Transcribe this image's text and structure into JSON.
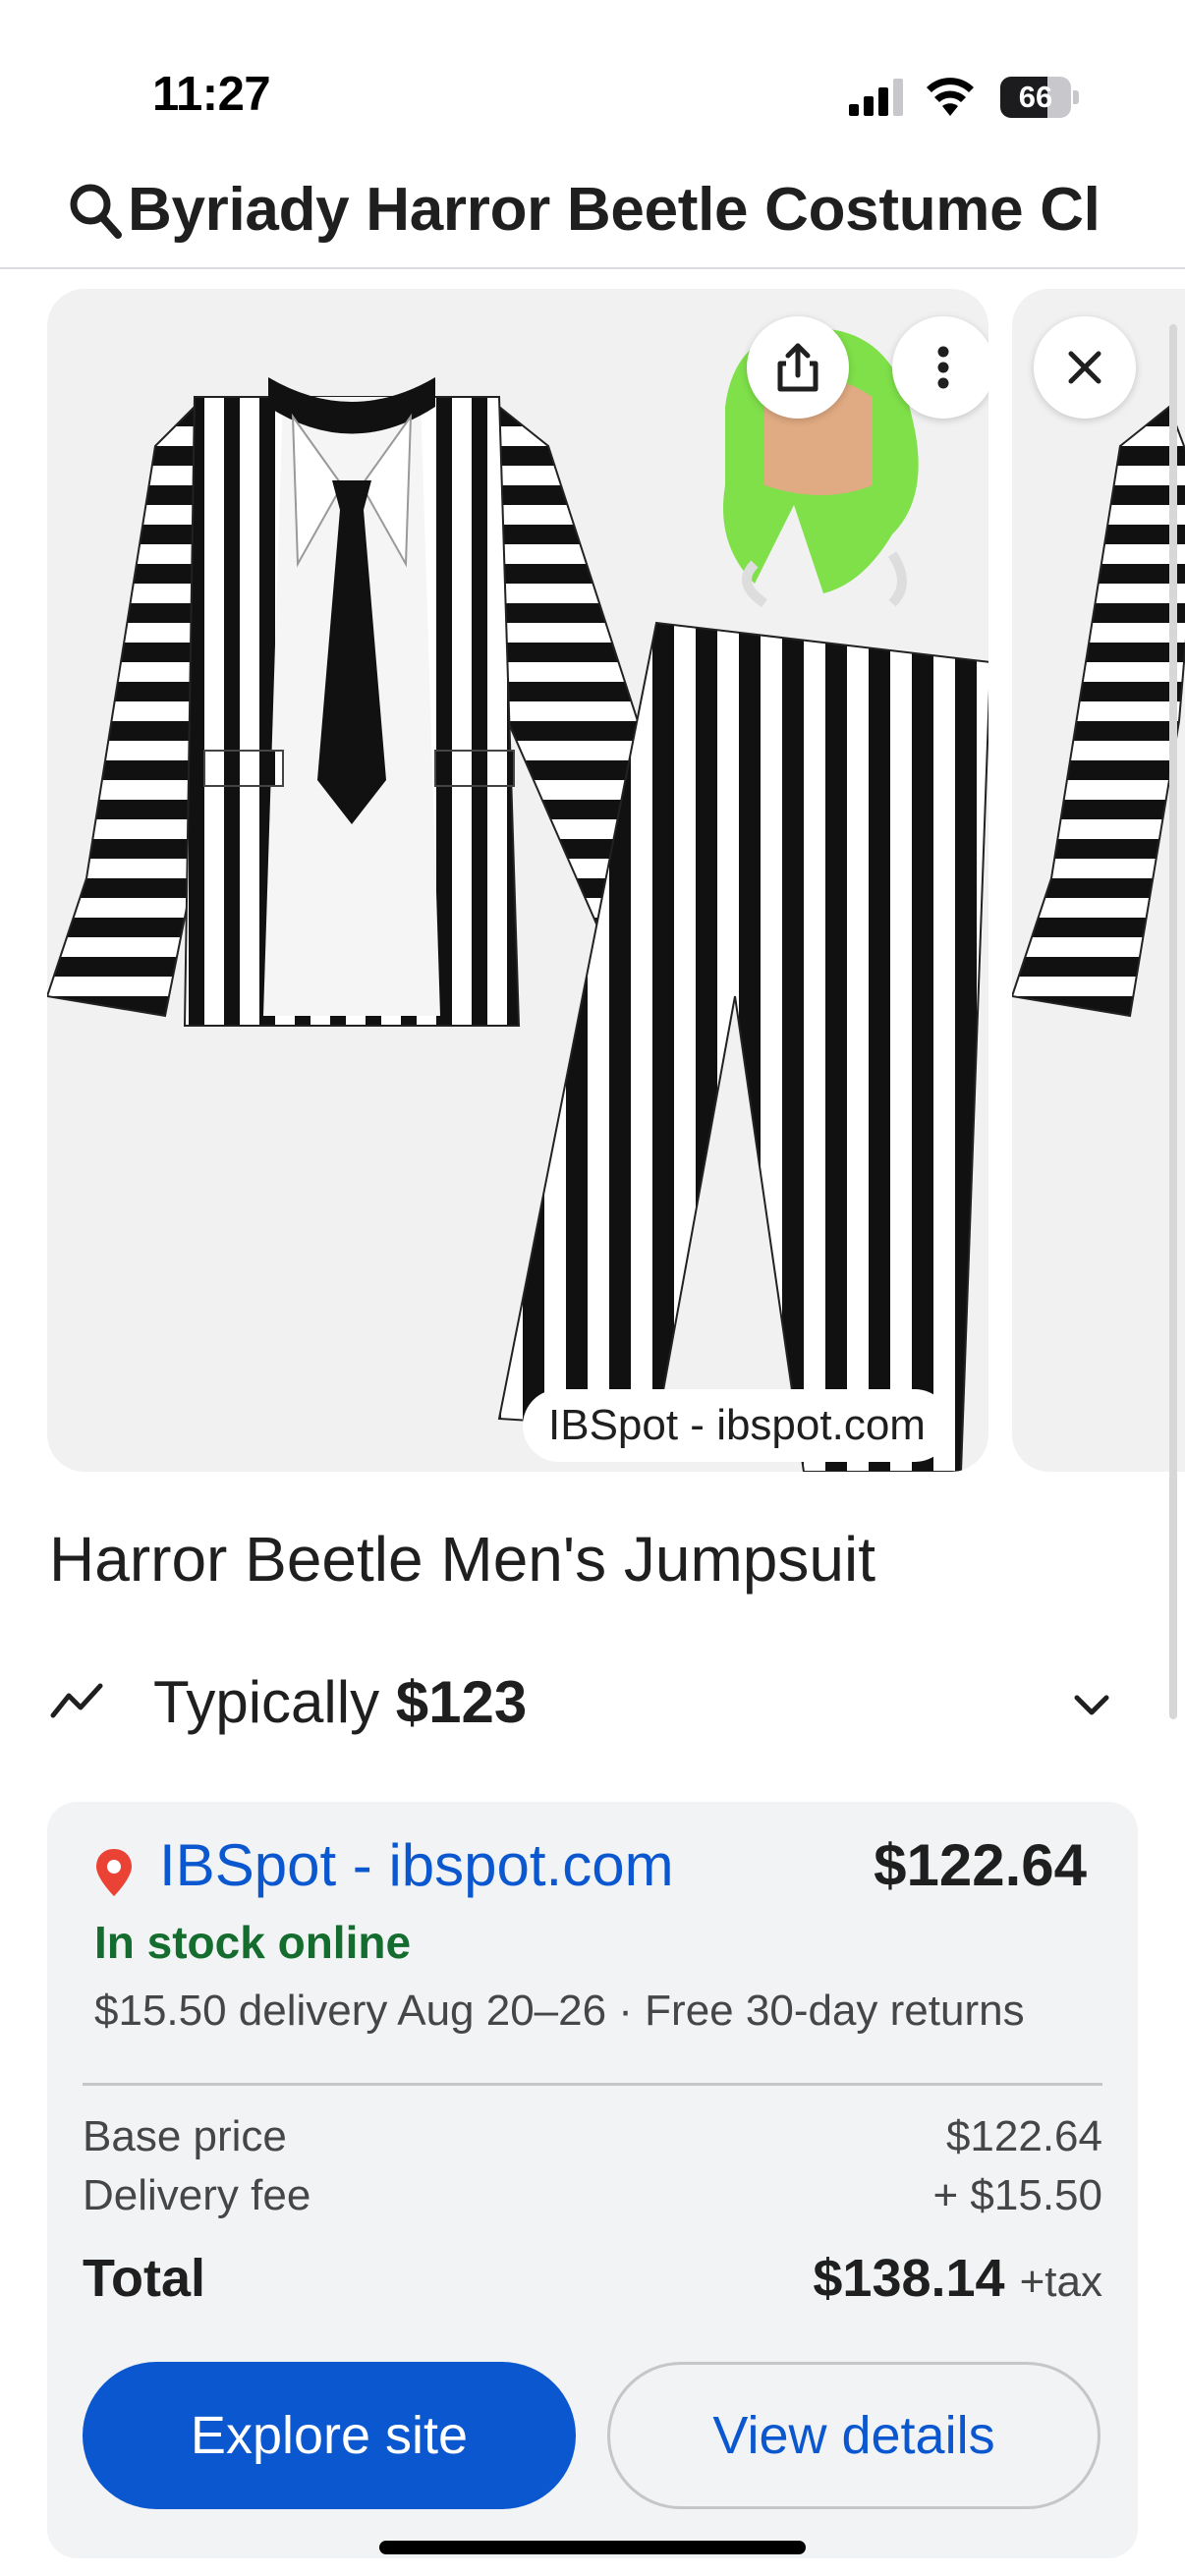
{
  "status_bar": {
    "time": "11:27",
    "battery_percent": "66",
    "battery_level": 0.66
  },
  "search": {
    "query": "Byriady Harror Beetle Costume Cl"
  },
  "image_card": {
    "source_label": "IBSpot - ibspot.com",
    "share_icon": "share-icon",
    "more_icon": "more-vert-icon",
    "close_icon": "close-icon"
  },
  "product": {
    "title": "Harror Beetle Men's Jumpsuit",
    "typical_label": "Typically",
    "typical_price": "$123"
  },
  "offer": {
    "merchant": "IBSpot - ibspot.com",
    "price": "$122.64",
    "stock": "In stock online",
    "delivery": "$15.50 delivery Aug 20–26 · Free 30-day returns",
    "base_price_label": "Base price",
    "base_price_value": "$122.64",
    "delivery_fee_label": "Delivery fee",
    "delivery_fee_value": "+ $15.50",
    "total_label": "Total",
    "total_value": "$138.14",
    "tax_label": "+tax",
    "explore_button": "Explore site",
    "details_button": "View details"
  },
  "colors": {
    "link_blue": "#0b57d0",
    "stock_green": "#146c2e",
    "merchant_pin": "#ea4335"
  }
}
